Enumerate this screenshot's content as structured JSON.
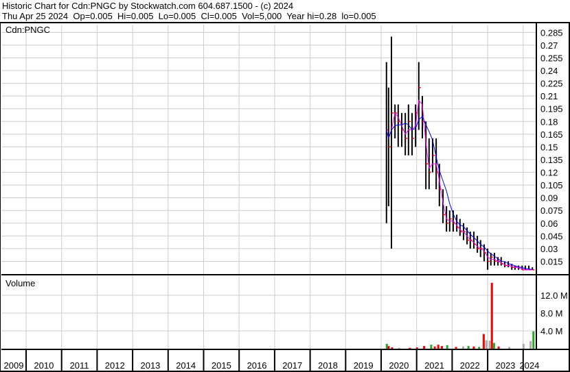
{
  "header": {
    "title": "Historic Chart for Cdn:PNGC by Stockwatch.com 604.687.1500 - (c) 2024",
    "quote": "Thu Apr 25 2024  Op=0.005  Hi=0.005  Lo=0.005  Cl=0.005  Vol=5,000  Year hi=0.28  lo=0.005"
  },
  "chart_data": {
    "type": "line",
    "title": "Cdn:PNGC",
    "volume_label": "Volume",
    "price_ticks": [
      "0.015",
      "0.03",
      "0.045",
      "0.06",
      "0.075",
      "0.09",
      "0.105",
      "0.12",
      "0.135",
      "0.15",
      "0.165",
      "0.18",
      "0.195",
      "0.21",
      "0.225",
      "0.24",
      "0.255",
      "0.27",
      "0.285"
    ],
    "ylim": [
      0,
      0.295
    ],
    "volume_ticks": [
      "4.0 M",
      "8.0 M",
      "12.0 M"
    ],
    "volume_tick_values": [
      4,
      8,
      12
    ],
    "years": [
      "2009",
      "2010",
      "2011",
      "2012",
      "2013",
      "2014",
      "2015",
      "2016",
      "2017",
      "2018",
      "2019",
      "2020",
      "2021",
      "2022",
      "2023",
      "2024"
    ],
    "colors": {
      "bar": "#000000",
      "close": "#ff0000",
      "ma_short": "#ff00ff",
      "ma_long": "#0000ff",
      "vol_up": "#22aa22",
      "vol_down": "#ff0000",
      "vol_flat": "#aaaaaa"
    },
    "ohlc": [
      [
        2020.15,
        0.25,
        0.06,
        0.17
      ],
      [
        2020.21,
        0.22,
        0.08,
        0.15
      ],
      [
        2020.29,
        0.28,
        0.03,
        0.19
      ],
      [
        2020.39,
        0.2,
        0.16,
        0.19
      ],
      [
        2020.48,
        0.2,
        0.15,
        0.18
      ],
      [
        2020.58,
        0.19,
        0.15,
        0.17
      ],
      [
        2020.68,
        0.19,
        0.14,
        0.16
      ],
      [
        2020.77,
        0.2,
        0.14,
        0.18
      ],
      [
        2020.87,
        0.19,
        0.14,
        0.16
      ],
      [
        2020.97,
        0.2,
        0.15,
        0.19
      ],
      [
        2021.06,
        0.25,
        0.17,
        0.22
      ],
      [
        2021.16,
        0.21,
        0.16,
        0.18
      ],
      [
        2021.26,
        0.18,
        0.1,
        0.13
      ],
      [
        2021.35,
        0.16,
        0.1,
        0.12
      ],
      [
        2021.45,
        0.16,
        0.12,
        0.14
      ],
      [
        2021.55,
        0.16,
        0.1,
        0.12
      ],
      [
        2021.64,
        0.13,
        0.08,
        0.1
      ],
      [
        2021.74,
        0.1,
        0.06,
        0.07
      ],
      [
        2021.84,
        0.08,
        0.05,
        0.06
      ],
      [
        2021.93,
        0.075,
        0.05,
        0.065
      ],
      [
        2022.03,
        0.075,
        0.05,
        0.06
      ],
      [
        2022.13,
        0.07,
        0.05,
        0.055
      ],
      [
        2022.22,
        0.065,
        0.045,
        0.05
      ],
      [
        2022.32,
        0.06,
        0.04,
        0.05
      ],
      [
        2022.42,
        0.055,
        0.035,
        0.04
      ],
      [
        2022.51,
        0.05,
        0.03,
        0.04
      ],
      [
        2022.61,
        0.05,
        0.03,
        0.035
      ],
      [
        2022.71,
        0.045,
        0.025,
        0.03
      ],
      [
        2022.8,
        0.04,
        0.02,
        0.03
      ],
      [
        2022.9,
        0.035,
        0.015,
        0.025
      ],
      [
        2023.0,
        0.03,
        0.005,
        0.015
      ],
      [
        2023.09,
        0.025,
        0.01,
        0.02
      ],
      [
        2023.19,
        0.025,
        0.01,
        0.015
      ],
      [
        2023.29,
        0.02,
        0.01,
        0.015
      ],
      [
        2023.38,
        0.02,
        0.01,
        0.012
      ],
      [
        2023.48,
        0.015,
        0.008,
        0.01
      ],
      [
        2023.58,
        0.015,
        0.008,
        0.01
      ],
      [
        2023.68,
        0.012,
        0.005,
        0.008
      ],
      [
        2023.77,
        0.01,
        0.005,
        0.008
      ],
      [
        2023.87,
        0.01,
        0.005,
        0.007
      ],
      [
        2023.97,
        0.01,
        0.005,
        0.005
      ],
      [
        2024.06,
        0.01,
        0.005,
        0.005
      ],
      [
        2024.16,
        0.01,
        0.005,
        0.005
      ],
      [
        2024.26,
        0.008,
        0.005,
        0.005
      ]
    ],
    "volume": [
      [
        2020.15,
        1.1,
        "up"
      ],
      [
        2020.2,
        0.6,
        "down"
      ],
      [
        2020.3,
        0.3,
        "down"
      ],
      [
        2020.5,
        0.2,
        "flat"
      ],
      [
        2020.8,
        0.2,
        "down"
      ],
      [
        2021.0,
        0.3,
        "down"
      ],
      [
        2021.2,
        0.6,
        "down"
      ],
      [
        2021.4,
        0.9,
        "up"
      ],
      [
        2021.5,
        0.5,
        "down"
      ],
      [
        2021.6,
        0.9,
        "down"
      ],
      [
        2021.7,
        0.6,
        "down"
      ],
      [
        2021.85,
        0.8,
        "up"
      ],
      [
        2022.1,
        0.4,
        "down"
      ],
      [
        2022.3,
        0.5,
        "flat"
      ],
      [
        2022.45,
        0.6,
        "up"
      ],
      [
        2022.6,
        0.5,
        "down"
      ],
      [
        2022.75,
        0.4,
        "up"
      ],
      [
        2022.88,
        3.3,
        "down"
      ],
      [
        2022.95,
        1.9,
        "flat"
      ],
      [
        2023.05,
        1.8,
        "flat"
      ],
      [
        2023.11,
        14.8,
        "down"
      ],
      [
        2023.17,
        1.3,
        "up"
      ],
      [
        2023.3,
        0.5,
        "down"
      ],
      [
        2023.6,
        0.4,
        "flat"
      ],
      [
        2024.0,
        1.1,
        "flat"
      ],
      [
        2024.2,
        1.7,
        "flat"
      ],
      [
        2024.28,
        3.9,
        "up"
      ]
    ]
  }
}
